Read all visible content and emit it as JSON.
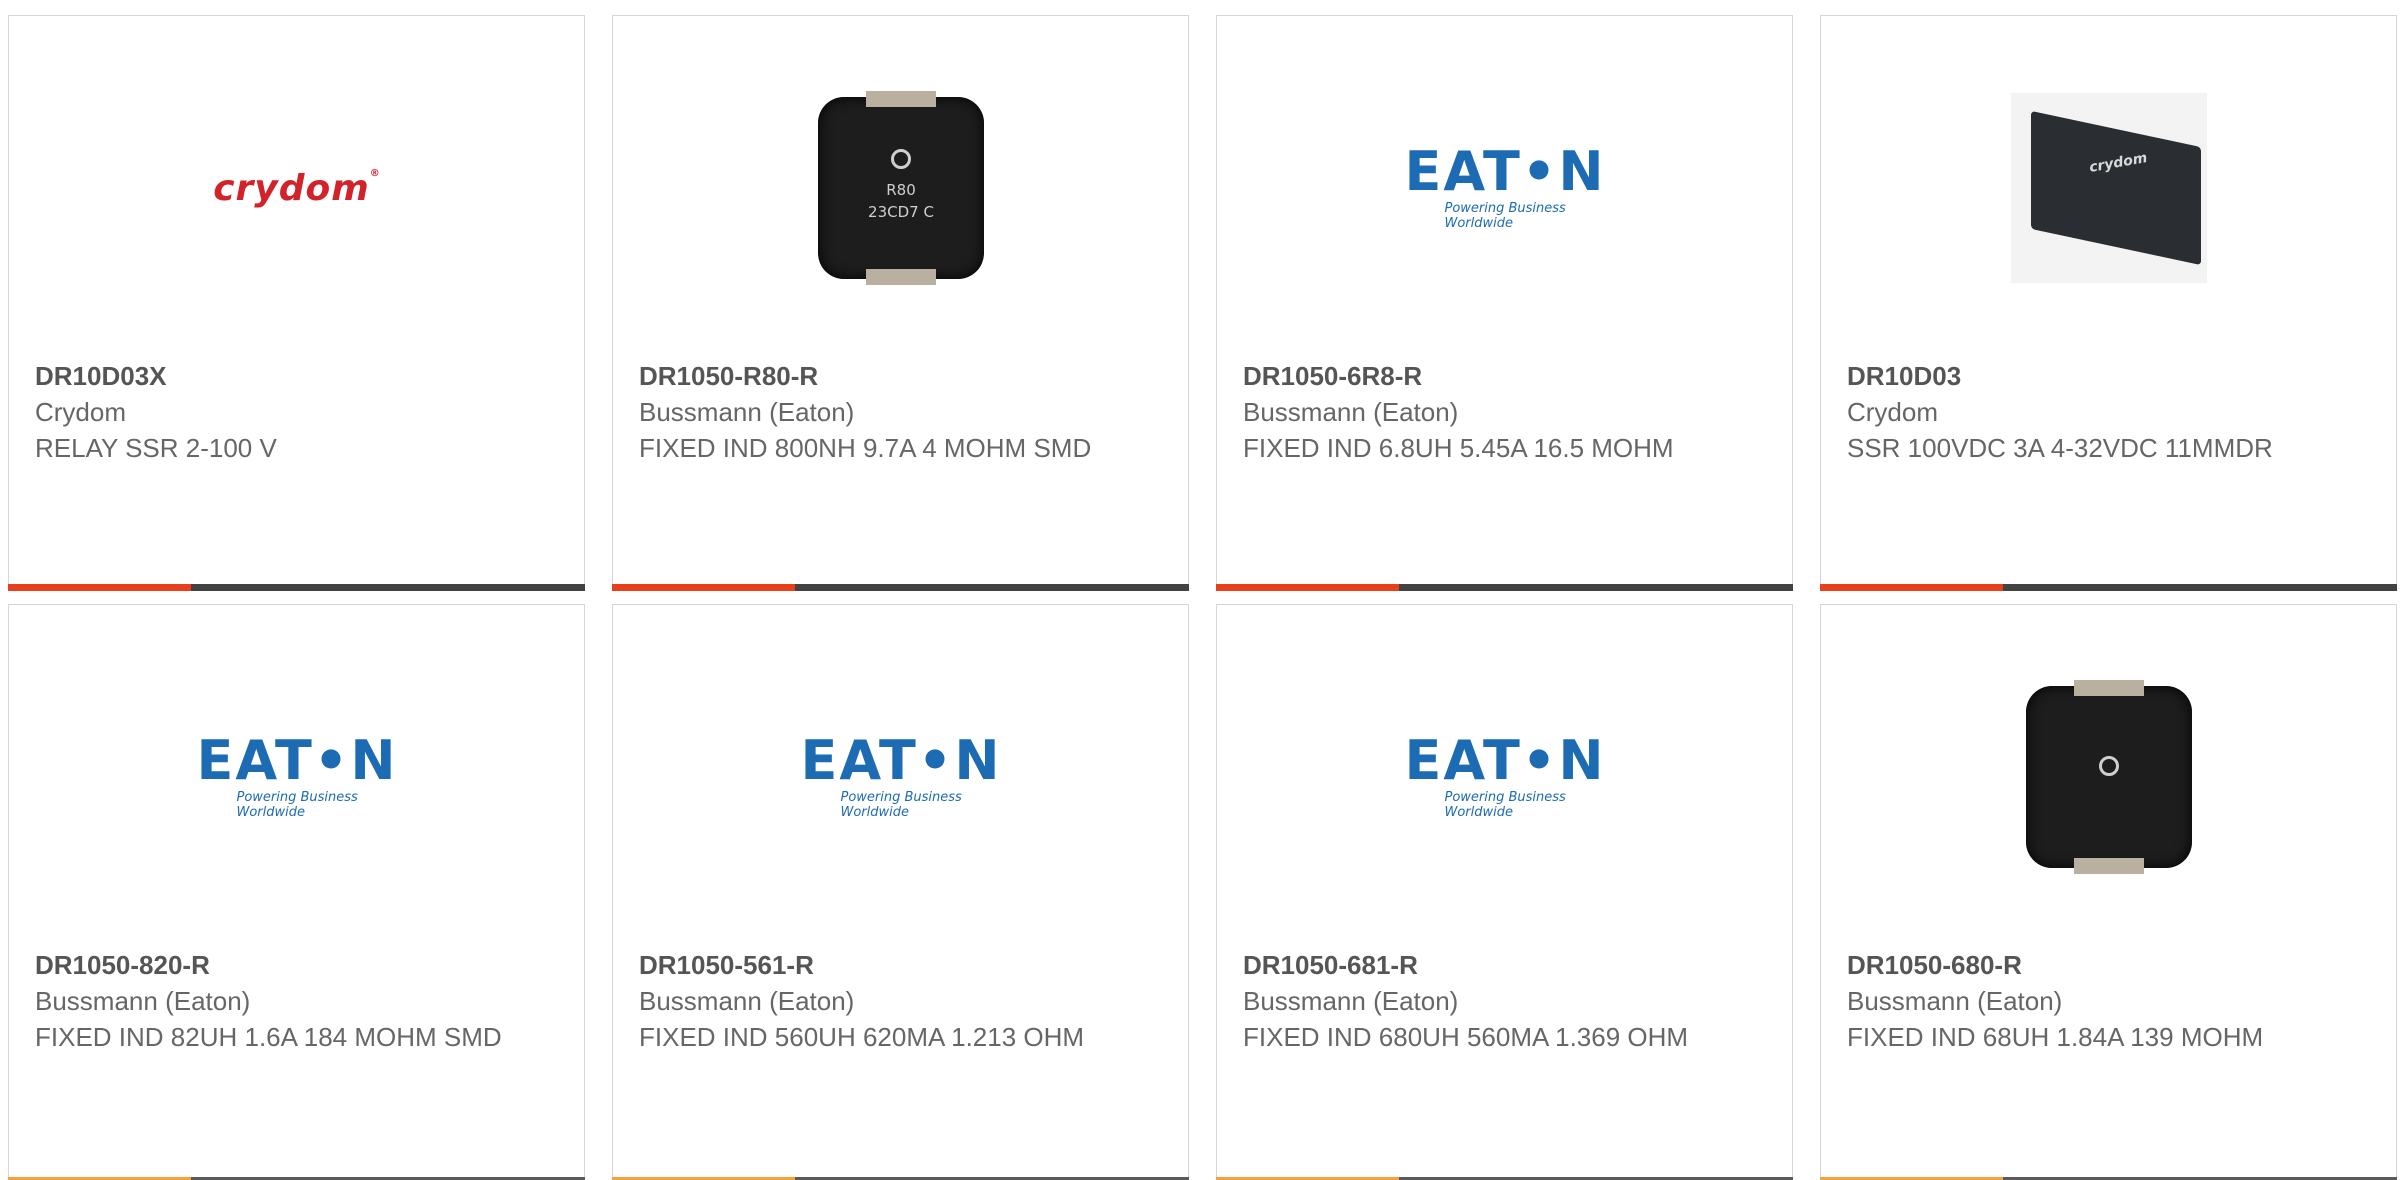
{
  "products": [
    {
      "part": "DR10D03X",
      "manufacturer": "Crydom",
      "description": "RELAY SSR 2-100 V",
      "image": "crydom-logo"
    },
    {
      "part": "DR1050-R80-R",
      "manufacturer": "Bussmann (Eaton)",
      "description": "FIXED IND 800NH 9.7A 4 MOHM SMD",
      "image": "inductor-photo",
      "image_text": [
        "R80",
        "23CD7 C"
      ]
    },
    {
      "part": "DR1050-6R8-R",
      "manufacturer": "Bussmann (Eaton)",
      "description": "FIXED IND 6.8UH 5.45A 16.5 MOHM",
      "image": "eaton-logo"
    },
    {
      "part": "DR10D03",
      "manufacturer": "Crydom",
      "description": "SSR 100VDC 3A 4-32VDC 11MMDR",
      "image": "ssr-photo"
    },
    {
      "part": "DR1050-820-R",
      "manufacturer": "Bussmann (Eaton)",
      "description": "FIXED IND 82UH 1.6A 184 MOHM SMD",
      "image": "eaton-logo"
    },
    {
      "part": "DR1050-561-R",
      "manufacturer": "Bussmann (Eaton)",
      "description": "FIXED IND 560UH 620MA 1.213 OHM",
      "image": "eaton-logo"
    },
    {
      "part": "DR1050-681-R",
      "manufacturer": "Bussmann (Eaton)",
      "description": "FIXED IND 680UH 560MA 1.369 OHM",
      "image": "eaton-logo"
    },
    {
      "part": "DR1050-680-R",
      "manufacturer": "Bussmann (Eaton)",
      "description": "FIXED IND 68UH 1.84A 139 MOHM",
      "image": "inductor-photo"
    }
  ],
  "logos": {
    "crydom": "crydom",
    "eaton_word": "EAT•N",
    "eaton_tagline": "Powering Business Worldwide"
  },
  "colors": {
    "accent_orange": "#e8401c",
    "accent_dark": "#434343",
    "eaton_blue": "#1d6bb3",
    "crydom_red": "#d2232a"
  }
}
